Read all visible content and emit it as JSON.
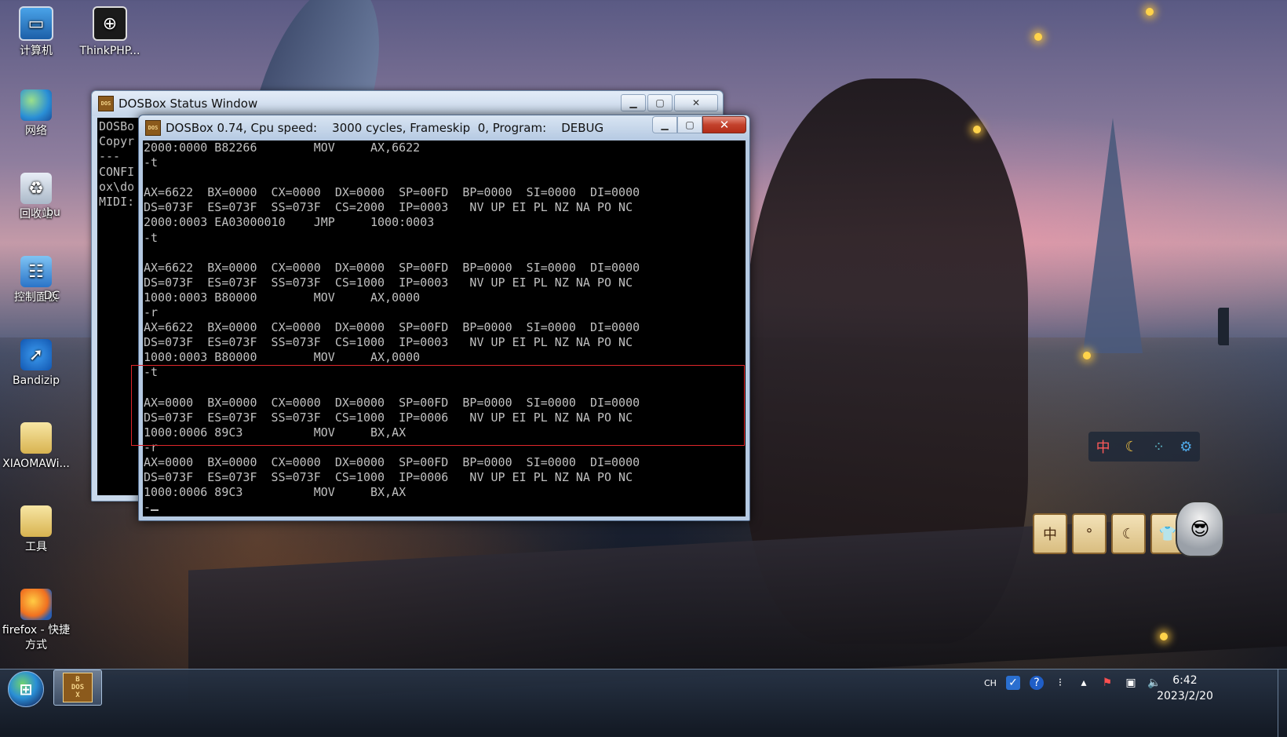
{
  "desktop": {
    "icons": [
      {
        "label": "计算机",
        "icon": "computer-icon"
      },
      {
        "label": "ThinkPHP...",
        "icon": "thinkphp-icon"
      },
      {
        "label": "网络",
        "icon": "network-icon"
      },
      {
        "label": "回收站",
        "icon": "recycle-bin-icon"
      },
      {
        "label": "控制面板",
        "icon": "control-panel-icon"
      },
      {
        "label": "Bandizip",
        "icon": "bandizip-icon"
      },
      {
        "label": "XIAOMAWi...",
        "icon": "folder-icon"
      },
      {
        "label": "工具",
        "icon": "folder-icon"
      },
      {
        "label": "firefox - 快捷方式",
        "icon": "firefox-icon"
      }
    ],
    "partial_labels": [
      "bu",
      "DC"
    ]
  },
  "status_window": {
    "title": "DOSBox Status Window",
    "console_lines": [
      "DOSBo",
      "Copyr",
      "---",
      "CONFI",
      "ox\\do",
      "MIDI:"
    ]
  },
  "dosbox_window": {
    "title": "DOSBox 0.74, Cpu speed:    3000 cycles, Frameskip  0, Program:    DEBUG",
    "lines": [
      "2000:0000 B82266        MOV     AX,6622",
      "-t",
      "",
      "AX=6622  BX=0000  CX=0000  DX=0000  SP=00FD  BP=0000  SI=0000  DI=0000",
      "DS=073F  ES=073F  SS=073F  CS=2000  IP=0003   NV UP EI PL NZ NA PO NC",
      "2000:0003 EA03000010    JMP     1000:0003",
      "-t",
      "",
      "AX=6622  BX=0000  CX=0000  DX=0000  SP=00FD  BP=0000  SI=0000  DI=0000",
      "DS=073F  ES=073F  SS=073F  CS=1000  IP=0003   NV UP EI PL NZ NA PO NC",
      "1000:0003 B80000        MOV     AX,0000",
      "-r",
      "AX=6622  BX=0000  CX=0000  DX=0000  SP=00FD  BP=0000  SI=0000  DI=0000",
      "DS=073F  ES=073F  SS=073F  CS=1000  IP=0003   NV UP EI PL NZ NA PO NC",
      "1000:0003 B80000        MOV     AX,0000",
      "-t",
      "",
      "AX=0000  BX=0000  CX=0000  DX=0000  SP=00FD  BP=0000  SI=0000  DI=0000",
      "DS=073F  ES=073F  SS=073F  CS=1000  IP=0006   NV UP EI PL NZ NA PO NC",
      "1000:0006 89C3          MOV     BX,AX",
      "-r",
      "AX=0000  BX=0000  CX=0000  DX=0000  SP=00FD  BP=0000  SI=0000  DI=0000",
      "DS=073F  ES=073F  SS=073F  CS=1000  IP=0006   NV UP EI PL NZ NA PO NC",
      "1000:0006 89C3          MOV     BX,AX",
      "-"
    ],
    "highlight_color": "#e0262a"
  },
  "widgets": {
    "ime_bar": [
      "中",
      "☾",
      "⁘",
      "⚙"
    ],
    "scroll_items": [
      "中",
      "°",
      "☾",
      "👕"
    ]
  },
  "taskbar": {
    "tray_lang": "CH",
    "clock_time": "6:42",
    "clock_date": "2023/2/20"
  },
  "colors": {
    "console_fg": "#c0c0c0",
    "console_bg": "#000000",
    "close_button": "#c2412c"
  }
}
